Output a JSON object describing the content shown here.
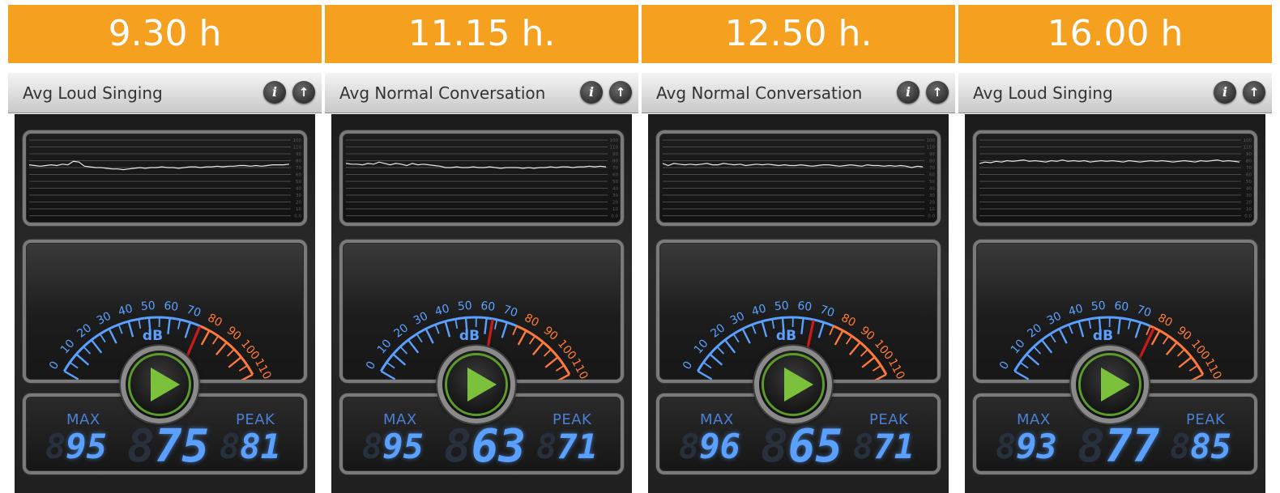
{
  "meter": {
    "scale_labels": [
      "0",
      "10",
      "20",
      "30",
      "40",
      "50",
      "60",
      "70",
      "80",
      "90",
      "100",
      "110"
    ],
    "unit_label": "dB",
    "max_label": "MAX",
    "peak_label": "PEAK",
    "graph_axis_labels": [
      "100",
      "110",
      "90",
      "80",
      "70",
      "60",
      "50",
      "40",
      "30",
      "20",
      "10",
      "0.0"
    ],
    "colors": {
      "low": "#5aa0ff",
      "high": "#ff7a3a",
      "needle": "#cc1a1a",
      "digits": "#5aa0ff",
      "header": "#f5a01f",
      "play": "#7bc13b"
    }
  },
  "icons": {
    "info": "info-icon",
    "upload": "arrow-up-icon",
    "play": "play-icon"
  },
  "panels": [
    {
      "time": "9.30 h",
      "title": "Avg Loud Singing",
      "info_glyph": "i",
      "up_glyph": "↑",
      "max": "95",
      "current": "75",
      "peak": "81",
      "needle_db": 75,
      "history_db": [
        74,
        73,
        72,
        73,
        74,
        73,
        75,
        74,
        79,
        78,
        72,
        71,
        70,
        70,
        69,
        68,
        68,
        67,
        68,
        69,
        70,
        69,
        70,
        70,
        71,
        70,
        70,
        69,
        70,
        71,
        71,
        70,
        71,
        71,
        72,
        71,
        72,
        72,
        73,
        73,
        72,
        73,
        72,
        73,
        74,
        74,
        74,
        75
      ]
    },
    {
      "time": "11.15 h.",
      "title": "Avg Normal Conversation",
      "info_glyph": "i",
      "up_glyph": "↑",
      "max": "95",
      "current": "63",
      "peak": "71",
      "needle_db": 63,
      "history_db": [
        76,
        75,
        75,
        74,
        76,
        75,
        78,
        76,
        74,
        76,
        75,
        73,
        76,
        74,
        75,
        74,
        73,
        72,
        70,
        70,
        71,
        70,
        70,
        71,
        70,
        70,
        71,
        70,
        69,
        70,
        70,
        70,
        69,
        70,
        69,
        70,
        70,
        71,
        70,
        71,
        71,
        70,
        71,
        71,
        72,
        71,
        72,
        71
      ]
    },
    {
      "time": "12.50 h.",
      "title": "Avg Normal Conversation",
      "info_glyph": "i",
      "up_glyph": "↑",
      "max": "96",
      "current": "65",
      "peak": "71",
      "needle_db": 65,
      "history_db": [
        76,
        73,
        76,
        75,
        74,
        75,
        74,
        75,
        76,
        74,
        74,
        76,
        75,
        74,
        75,
        73,
        74,
        75,
        74,
        75,
        74,
        73,
        74,
        73,
        73,
        74,
        73,
        72,
        73,
        74,
        74,
        73,
        72,
        73,
        74,
        73,
        72,
        74,
        73,
        73,
        72,
        73,
        72,
        73,
        72,
        70,
        72,
        71
      ]
    },
    {
      "time": "16.00 h",
      "title": "Avg Loud Singing",
      "info_glyph": "i",
      "up_glyph": "↑",
      "max": "93",
      "current": "77",
      "peak": "85",
      "needle_db": 77,
      "history_db": [
        76,
        78,
        77,
        79,
        78,
        80,
        79,
        80,
        81,
        79,
        80,
        79,
        78,
        80,
        79,
        81,
        79,
        80,
        79,
        80,
        78,
        79,
        80,
        79,
        80,
        79,
        78,
        80,
        79,
        78,
        79,
        80,
        79,
        80,
        79,
        78,
        79,
        80,
        79,
        78,
        80,
        79,
        80,
        81,
        79,
        80,
        79,
        78
      ]
    }
  ]
}
